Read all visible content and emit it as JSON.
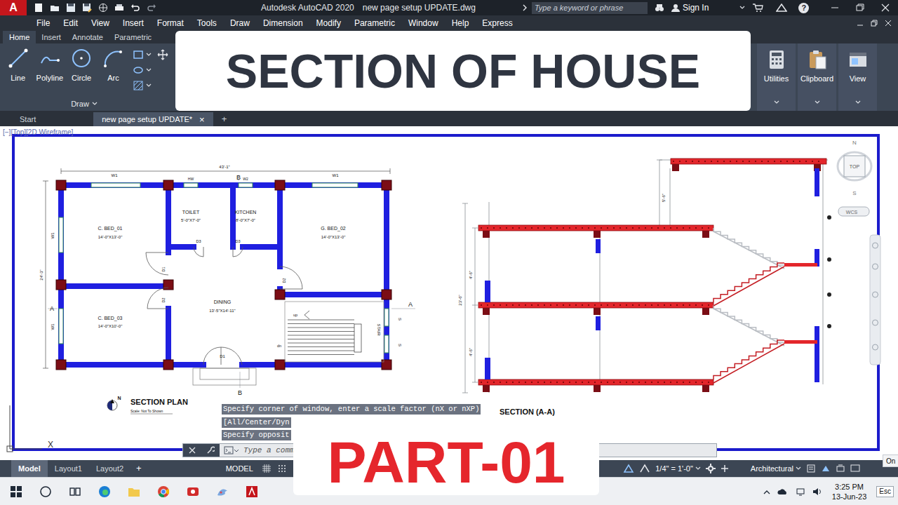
{
  "title_bar": {
    "logo": "A",
    "app_title": "Autodesk AutoCAD 2020",
    "file_name": "new page setup UPDATE.dwg",
    "search_placeholder": "Type a keyword or phrase",
    "sign_in": "Sign In",
    "help": "?"
  },
  "menu": [
    "File",
    "Edit",
    "View",
    "Insert",
    "Format",
    "Tools",
    "Draw",
    "Dimension",
    "Modify",
    "Parametric",
    "Window",
    "Help",
    "Express"
  ],
  "ribbon_tabs": [
    {
      "label": "Home",
      "selected": true
    },
    {
      "label": "Insert",
      "selected": false
    },
    {
      "label": "Annotate",
      "selected": false
    },
    {
      "label": "Parametric",
      "selected": false
    }
  ],
  "draw_tools": [
    "Line",
    "Polyline",
    "Circle",
    "Arc"
  ],
  "draw_panel": "Draw",
  "right_panels": [
    "Utilities",
    "Clipboard",
    "View"
  ],
  "file_tabs": [
    {
      "label": "Start",
      "selected": false,
      "closable": false
    },
    {
      "label": "new page setup UPDATE*",
      "selected": true,
      "closable": true
    }
  ],
  "close_glyph": "×",
  "new_tab": "+",
  "viewport_label": "[−][Top][2D Wireframe]",
  "nav_cube": {
    "top": "TOP",
    "north": "N",
    "south": "S",
    "wcs": "WCS"
  },
  "ucs_x": "X",
  "plan": {
    "labels": [
      "43'-1\"",
      "24'-3\"",
      "W1",
      "W1",
      "HW",
      "W2",
      "B",
      "B",
      "A",
      "A",
      "TOILET",
      "5'-0\"X7'-0\"",
      "KITCHEN",
      "8'-0\"X7'-0\"",
      "C. BED_01",
      "14'-0\"X13'-0\"",
      "G. BED_02",
      "14'-0\"X13'-0\"",
      "C. BED_03",
      "14'-0\"X10'-0\"",
      "DINING",
      "13'-5\"X14'-11\"",
      "D3",
      "D3",
      "D1",
      "D2",
      "D2",
      "D1",
      "up",
      "dn",
      "STAIR",
      "W1",
      "W1",
      "S",
      "S"
    ],
    "title": "SECTION PLAN",
    "scale": "Scale: Not To Shown",
    "north": "N"
  },
  "section": {
    "labels": [
      "23'-6\"",
      "4'-6\"",
      "4'-6\"",
      "5'-6\""
    ],
    "title": "SECTION (A-A)"
  },
  "command_history": [
    "Specify corner of window, enter a scale factor (nX or nXP)",
    "[All/Center/Dyn",
    "Specify opposit"
  ],
  "command_input": {
    "placeholder": "Type a comm"
  },
  "status_bar": {
    "layout_tabs": [
      {
        "label": "Model",
        "selected": true
      },
      {
        "label": "Layout1",
        "selected": false
      },
      {
        "label": "Layout2",
        "selected": false
      }
    ],
    "add": "+",
    "model": "MODEL",
    "scale": "1/4\" = 1'-0\"",
    "units": "Architectural"
  },
  "notification": "On",
  "taskbar": {
    "time": "3:25 PM",
    "date": "13-Jun-23",
    "esc": "Esc"
  },
  "thumbnail": {
    "headline": "SECTION OF HOUSE",
    "part": "PART-01"
  }
}
